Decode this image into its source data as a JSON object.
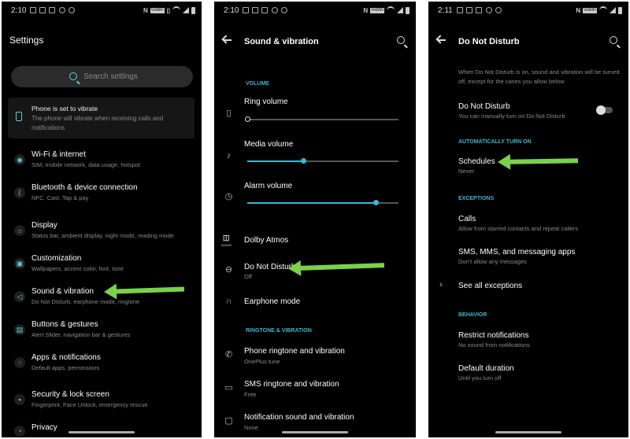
{
  "p1": {
    "status_time": "2:10",
    "title": "Settings",
    "search_placeholder": "Search settings",
    "notice_title": "Phone is set to vibrate",
    "notice_desc": "The phone will vibrate when receiving calls and notifications",
    "items": [
      {
        "title": "Wi-Fi & internet",
        "sub": "SIM, mobile network, data usage, hotspot"
      },
      {
        "title": "Bluetooth & device connection",
        "sub": "NFC, Cast, Tap & pay"
      },
      {
        "title": "Display",
        "sub": "Status bar, ambient display, night mode, reading mode"
      },
      {
        "title": "Customization",
        "sub": "Wallpapers, accent color, font, tone"
      },
      {
        "title": "Sound & vibration",
        "sub": "Do Not Disturb, earphone mode, ringtone"
      },
      {
        "title": "Buttons & gestures",
        "sub": "Alert Slider, navigation bar & gestures"
      },
      {
        "title": "Apps & notifications",
        "sub": "Default apps, permissions"
      },
      {
        "title": "Security & lock screen",
        "sub": "Fingerprint, Face Unlock, emergency rescue"
      },
      {
        "title": "Privacy",
        "sub": ""
      }
    ]
  },
  "p2": {
    "status_time": "2:10",
    "title": "Sound & vibration",
    "section_volume": "VOLUME",
    "ring_volume": "Ring volume",
    "media_volume": "Media volume",
    "alarm_volume": "Alarm volume",
    "ring_level": 0.0,
    "media_level": 0.37,
    "alarm_level": 0.85,
    "dolby": "Dolby Atmos",
    "dolby_logo": "DOLBY",
    "dnd_title": "Do Not Disturb",
    "dnd_sub": "Off",
    "earphone": "Earphone mode",
    "section_ringtone": "RINGTONE & VIBRATION",
    "phone_ringtone": "Phone ringtone and vibration",
    "phone_ringtone_sub": "OnePlus tune",
    "sms_ringtone": "SMS ringtone and vibration",
    "sms_ringtone_sub": "Free",
    "notif_sound": "Notification sound and vibration",
    "notif_sound_sub": "None"
  },
  "p3": {
    "status_time": "2:11",
    "title": "Do Not Disturb",
    "intro": "When Do Not Disturb is on, sound and vibration will be turned off, except for the cases you allow below",
    "dnd_title": "Do Not Disturb",
    "dnd_sub": "You can manually turn on Do Not Disturb",
    "section_auto": "AUTOMATICALLY TURN ON",
    "schedules": "Schedules",
    "schedules_sub": "Never",
    "section_exceptions": "EXCEPTIONS",
    "calls": "Calls",
    "calls_sub": "Allow from starred contacts and repeat callers",
    "sms": "SMS, MMS, and messaging apps",
    "sms_sub": "Don't allow any messages",
    "see_all": "See all exceptions",
    "section_behavior": "BEHAVIOR",
    "restrict": "Restrict notifications",
    "restrict_sub": "No sound from notifications",
    "duration": "Default duration",
    "duration_sub": "Until you turn off"
  },
  "status_vowifi": "VoWiFi",
  "status_nfc": "N",
  "colors": {
    "accent": "#3ab7cf",
    "arrow": "#7bd14b",
    "background": "#000000"
  }
}
